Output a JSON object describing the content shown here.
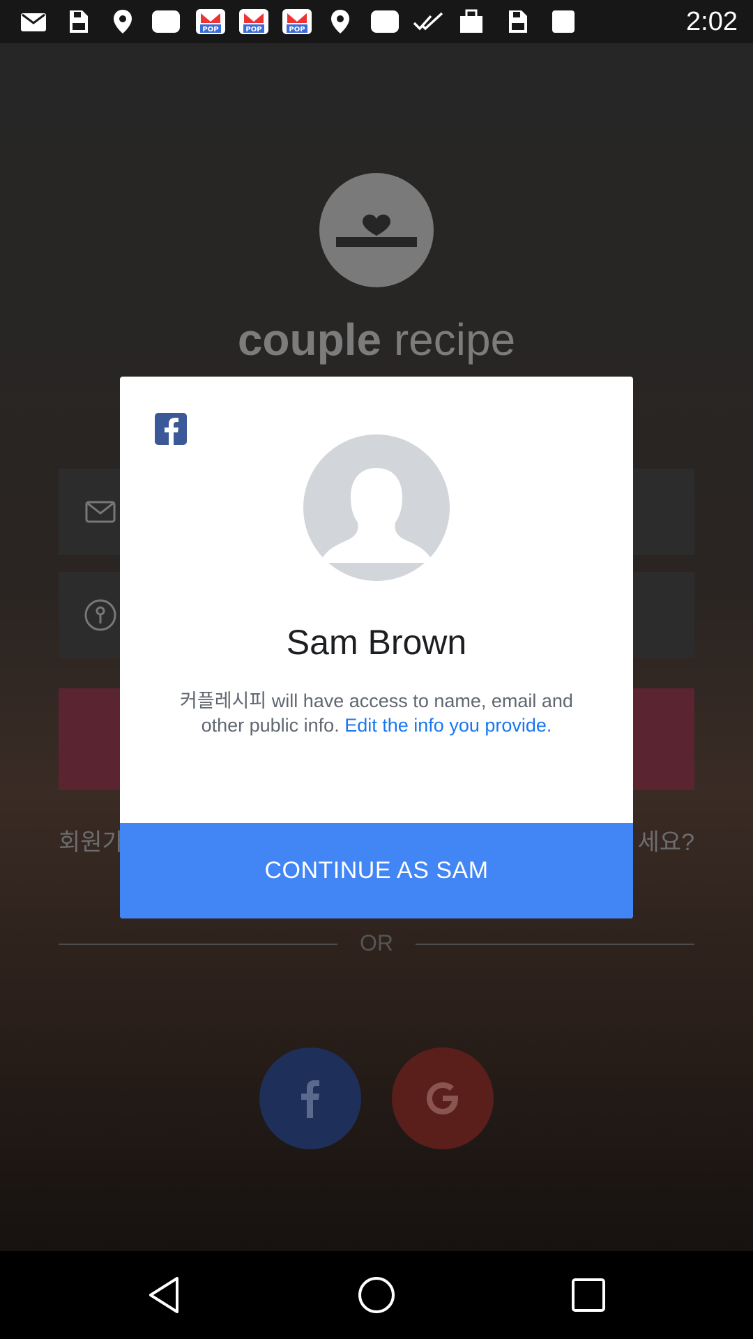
{
  "status_bar": {
    "time": "2:02",
    "notification_icons": [
      "gmail-icon",
      "save-icon",
      "location-icon",
      "chat-icon",
      "pop-game-icon",
      "pop-game-icon",
      "location-icon",
      "chat-icon",
      "check-icon",
      "bag-icon",
      "save-icon",
      "app-icon"
    ]
  },
  "background_app": {
    "logo_bold": "couple",
    "logo_light": "recipe",
    "bottom_left_text": "회원가",
    "bottom_right_text": "세요?",
    "or_label": "OR"
  },
  "dialog": {
    "user_name": "Sam Brown",
    "info_text": "커플레시피 will have access to name, email and other public info.",
    "edit_link": "Edit the info you provide.",
    "continue_label": "CONTINUE AS SAM"
  },
  "colors": {
    "facebook_blue": "#3b5998",
    "continue_button": "#4285f4",
    "link": "#1877f2"
  }
}
